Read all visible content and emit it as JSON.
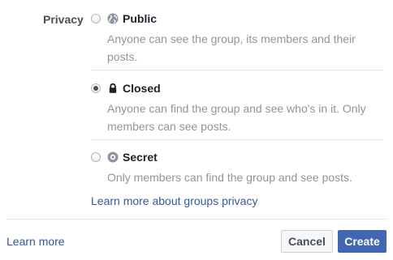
{
  "privacy": {
    "label": "Privacy",
    "selected": "closed",
    "options": [
      {
        "id": "public",
        "title": "Public",
        "icon": "globe-icon",
        "description": "Anyone can see the group, its members and their posts."
      },
      {
        "id": "closed",
        "title": "Closed",
        "icon": "lock-icon",
        "description": "Anyone can find the group and see who's in it. Only members can see posts."
      },
      {
        "id": "secret",
        "title": "Secret",
        "icon": "secret-circle-icon",
        "description": "Only members can find the group and see posts."
      }
    ],
    "learn_more_link": "Learn more about groups privacy"
  },
  "footer": {
    "learn_more": "Learn more",
    "cancel_label": "Cancel",
    "create_label": "Create"
  },
  "colors": {
    "link": "#365899",
    "primary_button": "#4267b2",
    "secondary_text": "#90949c"
  }
}
